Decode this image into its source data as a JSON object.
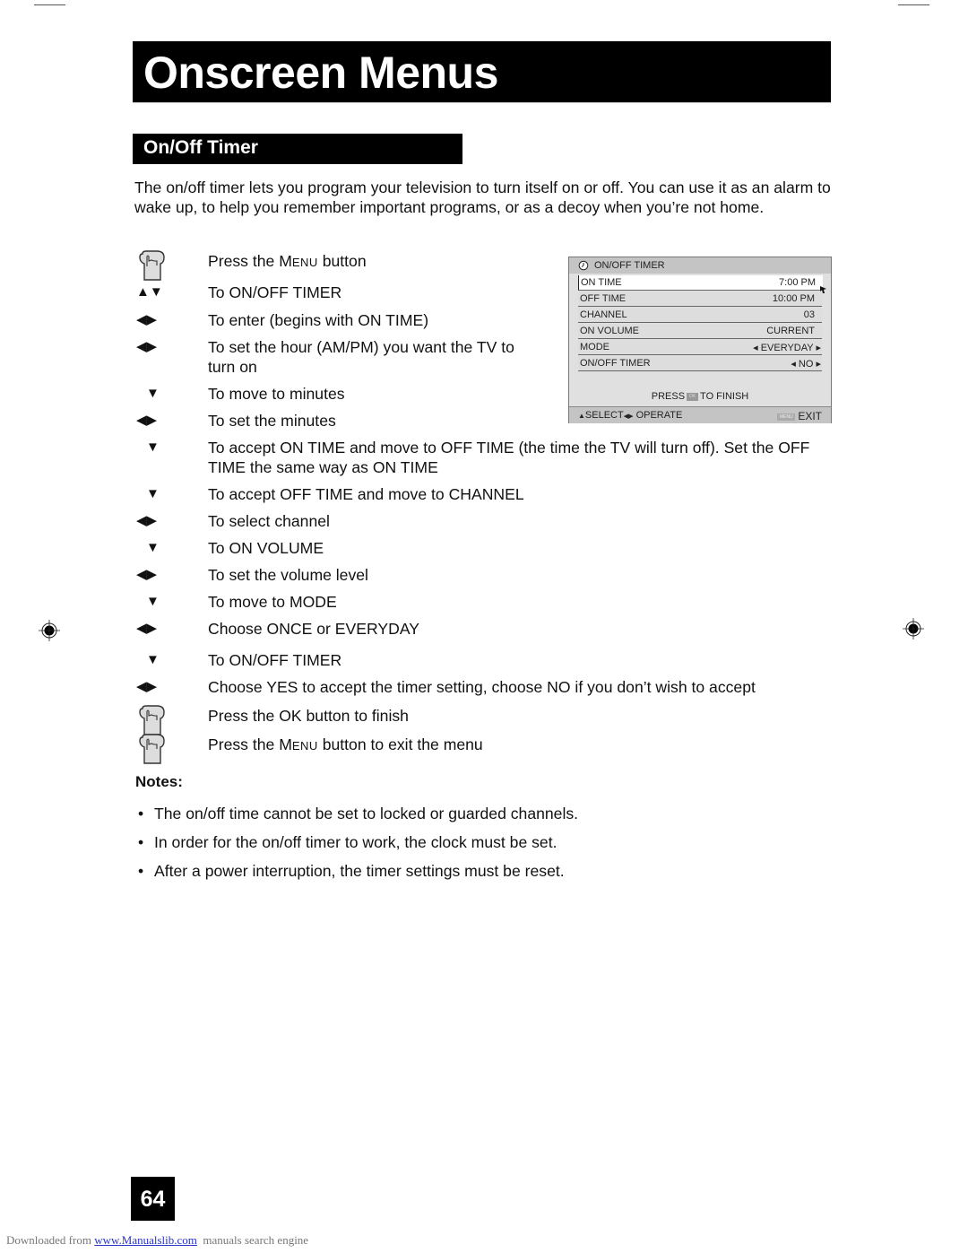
{
  "header": {
    "title": "Onscreen Menus"
  },
  "section": {
    "title": "On/Off Timer"
  },
  "intro": "The on/off timer lets you program your television to turn itself on or off. You can use it as an alarm to wake up, to help you remember important programs, or as a decoy when you’re not home.",
  "steps": [
    {
      "icon": "hand-press-icon",
      "pre": "Press the ",
      "sc": "Menu",
      "post": " button"
    },
    {
      "icon": "up-down-arrows-icon",
      "glyph": "▲▼",
      "text": "To ON/OFF TIMER"
    },
    {
      "icon": "left-right-arrows-icon",
      "glyph": "◀▶",
      "text": "To enter (begins with ON TIME)"
    },
    {
      "icon": "left-right-arrows-icon",
      "glyph": "◀▶",
      "text": "To set the hour (AM/PM) you want the TV to turn on"
    },
    {
      "icon": "down-arrow-icon",
      "glyph": "▼",
      "text": "To move to minutes"
    },
    {
      "icon": "left-right-arrows-icon",
      "glyph": "◀▶",
      "text": "To set the minutes"
    },
    {
      "icon": "down-arrow-icon",
      "glyph": "▼",
      "text": "To accept ON TIME and move to OFF TIME (the time the TV will turn off). Set the OFF TIME the same way as ON TIME"
    },
    {
      "icon": "down-arrow-icon",
      "glyph": "▼",
      "text": "To accept OFF TIME and move to CHANNEL"
    },
    {
      "icon": "left-right-arrows-icon",
      "glyph": "◀▶",
      "text": "To select channel"
    },
    {
      "icon": "down-arrow-icon",
      "glyph": "▼",
      "text": "To ON VOLUME"
    },
    {
      "icon": "left-right-arrows-icon",
      "glyph": "◀▶",
      "text": "To set the volume level"
    },
    {
      "icon": "down-arrow-icon",
      "glyph": "▼",
      "text": "To move to MODE"
    },
    {
      "icon": "left-right-arrows-icon",
      "glyph": "◀▶",
      "text": "Choose ONCE or EVERYDAY"
    },
    {
      "icon": "down-arrow-icon",
      "glyph": "▼",
      "text": "To ON/OFF TIMER"
    },
    {
      "icon": "left-right-arrows-icon",
      "glyph": "◀▶",
      "text": "Choose YES to accept the timer setting, choose NO if you don’t wish to accept"
    },
    {
      "icon": "hand-press-icon",
      "text": "Press the OK button to finish"
    },
    {
      "icon": "hand-press-icon",
      "pre": "Press the ",
      "sc": "Menu",
      "post": " button to exit the menu"
    }
  ],
  "osd": {
    "title": "ON/OFF TIMER",
    "rows": [
      {
        "label": "ON TIME",
        "value": "7:00 PM",
        "selected": true
      },
      {
        "label": "OFF TIME",
        "value": "10:00 PM"
      },
      {
        "label": "CHANNEL",
        "value": "03"
      },
      {
        "label": "ON VOLUME",
        "value": "CURRENT"
      },
      {
        "label": "MODE",
        "value": "EVERYDAY",
        "arrows": true
      },
      {
        "label": "ON/OFF TIMER",
        "value": "NO",
        "arrows": true
      }
    ],
    "finish_pre": "PRESS",
    "ok_label": "OK",
    "finish_post": "TO FINISH",
    "select_label": "SELECT",
    "operate_label": "OPERATE",
    "menu_chip": "MENU",
    "exit_label": "EXIT"
  },
  "notes": {
    "label": "Notes:",
    "items": [
      "The on/off time cannot be set to locked or guarded channels.",
      "In order for the on/off timer to work, the clock must be set.",
      "After a power interruption, the timer settings must be reset."
    ]
  },
  "page_number": "64",
  "footer": {
    "pre": "Downloaded from ",
    "link": "www.Manualslib.com",
    "post": "  manuals search engine"
  }
}
